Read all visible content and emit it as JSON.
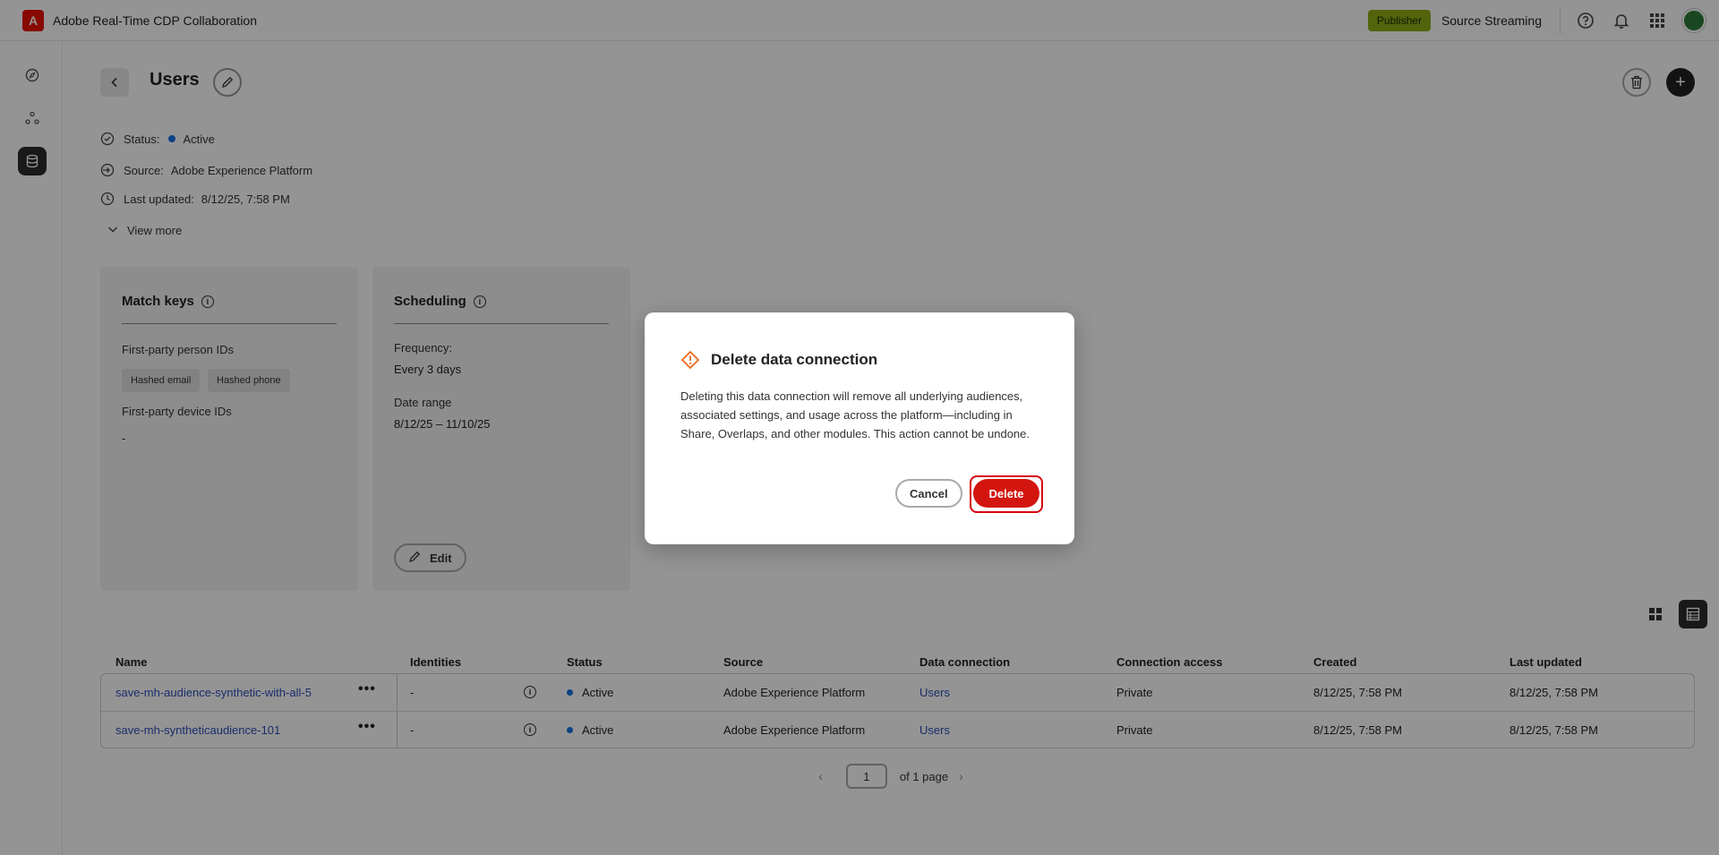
{
  "app": {
    "title": "Adobe Real-Time CDP Collaboration",
    "logo_letter": "A",
    "role_badge": "Publisher",
    "org_name": "Source Streaming"
  },
  "header": {
    "title": "Users"
  },
  "meta": {
    "status_label": "Status:",
    "status_value": "Active",
    "source_label": "Source:",
    "source_value": "Adobe Experience Platform",
    "updated_label": "Last updated:",
    "updated_value": "8/12/25, 7:58 PM",
    "view_more": "View more"
  },
  "match_keys": {
    "title": "Match keys",
    "person_ids_label": "First-party person IDs",
    "chips": [
      "Hashed email",
      "Hashed phone"
    ],
    "device_ids_label": "First-party device IDs",
    "device_ids_value": "-"
  },
  "scheduling": {
    "title": "Scheduling",
    "frequency_label": "Frequency:",
    "frequency_value": "Every 3 days",
    "date_range_label": "Date range",
    "date_range_value": "8/12/25 – 11/10/25",
    "edit_label": "Edit"
  },
  "table": {
    "columns": [
      "Name",
      "Identities",
      "Status",
      "Source",
      "Data connection",
      "Connection access",
      "Created",
      "Last updated"
    ],
    "rows": [
      {
        "name": "save-mh-audience-synthetic-with-all-5",
        "identities": "-",
        "status": "Active",
        "source": "Adobe Experience Platform",
        "data_connection": "Users",
        "access": "Private",
        "created": "8/12/25, 7:58 PM",
        "updated": "8/12/25, 7:58 PM"
      },
      {
        "name": "save-mh-syntheticaudience-101",
        "identities": "-",
        "status": "Active",
        "source": "Adobe Experience Platform",
        "data_connection": "Users",
        "access": "Private",
        "created": "8/12/25, 7:58 PM",
        "updated": "8/12/25, 7:58 PM"
      }
    ]
  },
  "pagination": {
    "current": "1",
    "total_label": "of 1 page"
  },
  "dialog": {
    "title": "Delete data connection",
    "body": "Deleting this data connection will remove all underlying audiences, associated settings, and usage across the platform—including in Share, Overlaps, and other modules. This action cannot be undone.",
    "cancel_label": "Cancel",
    "delete_label": "Delete"
  },
  "colors": {
    "brand": "#eb1000",
    "publisher_badge": "#8fac17",
    "delete": "#d31510",
    "warning": "#e86a1b",
    "link": "#2b4fb8",
    "status_active": "#1473e6"
  },
  "icons": {
    "nav": [
      "explore-icon",
      "collaboration-icon",
      "data-connections-icon"
    ],
    "top": [
      "help-icon",
      "bell-icon",
      "apps-grid-icon"
    ]
  }
}
